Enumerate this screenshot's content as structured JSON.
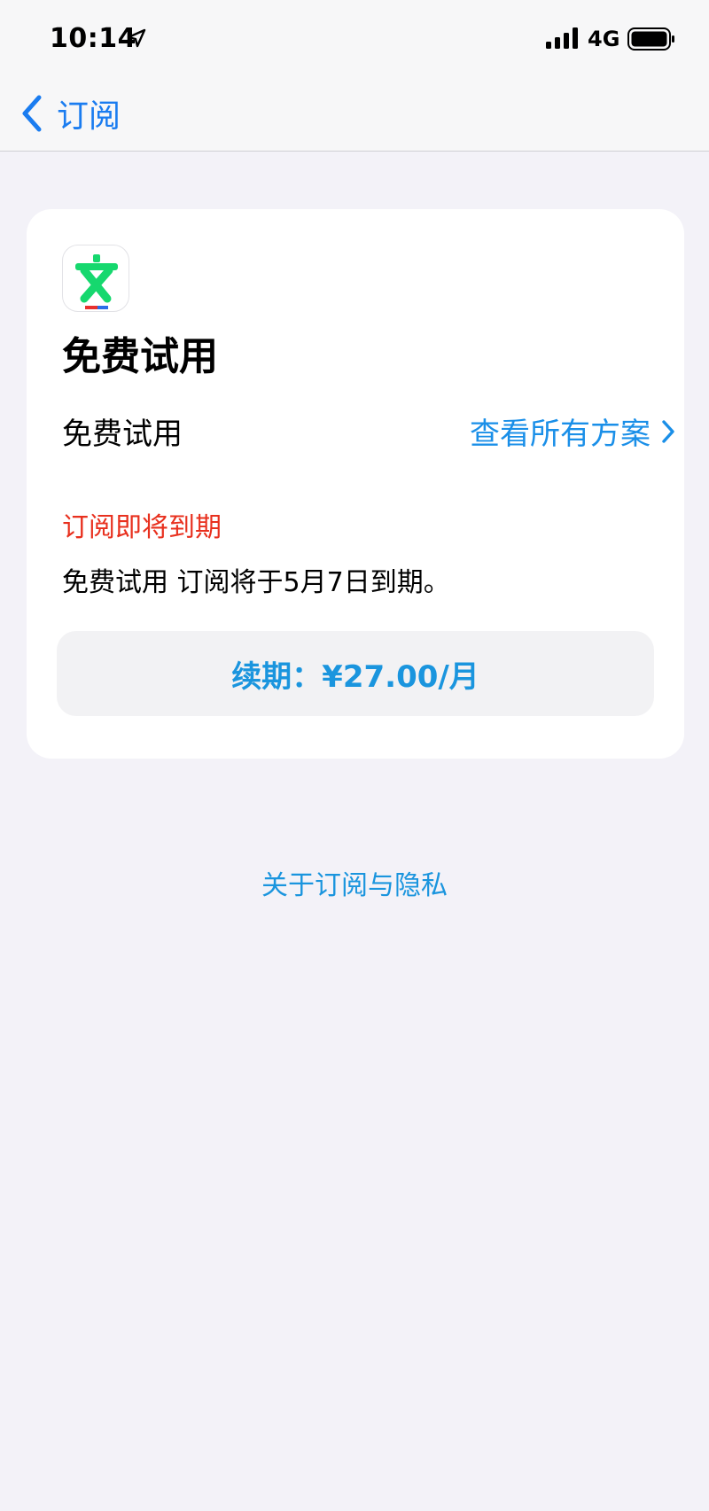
{
  "status_bar": {
    "time": "10:14",
    "location_icon": "location-arrow-icon",
    "signal_icon": "cellular-signal-icon",
    "network": "4G",
    "battery_icon": "battery-icon"
  },
  "nav": {
    "back_icon": "chevron-left-icon",
    "back_label": "订阅"
  },
  "subscription": {
    "app_icon": "app-logo-icon",
    "app_title": "免费试用",
    "plan_name": "免费试用",
    "view_all_label": "查看所有方案",
    "warning": "订阅即将到期",
    "expiry_detail": "免费试用 订阅将于5月7日到期。",
    "renew_label": "续期：¥27.00/月"
  },
  "footer": {
    "privacy_link": "关于订阅与隐私"
  },
  "colors": {
    "accent": "#1a8fe8",
    "warning": "#e8301e",
    "background": "#f3f2f8",
    "logo_green": "#16d86e",
    "logo_red": "#e8302e",
    "logo_blue": "#2b6de8"
  }
}
